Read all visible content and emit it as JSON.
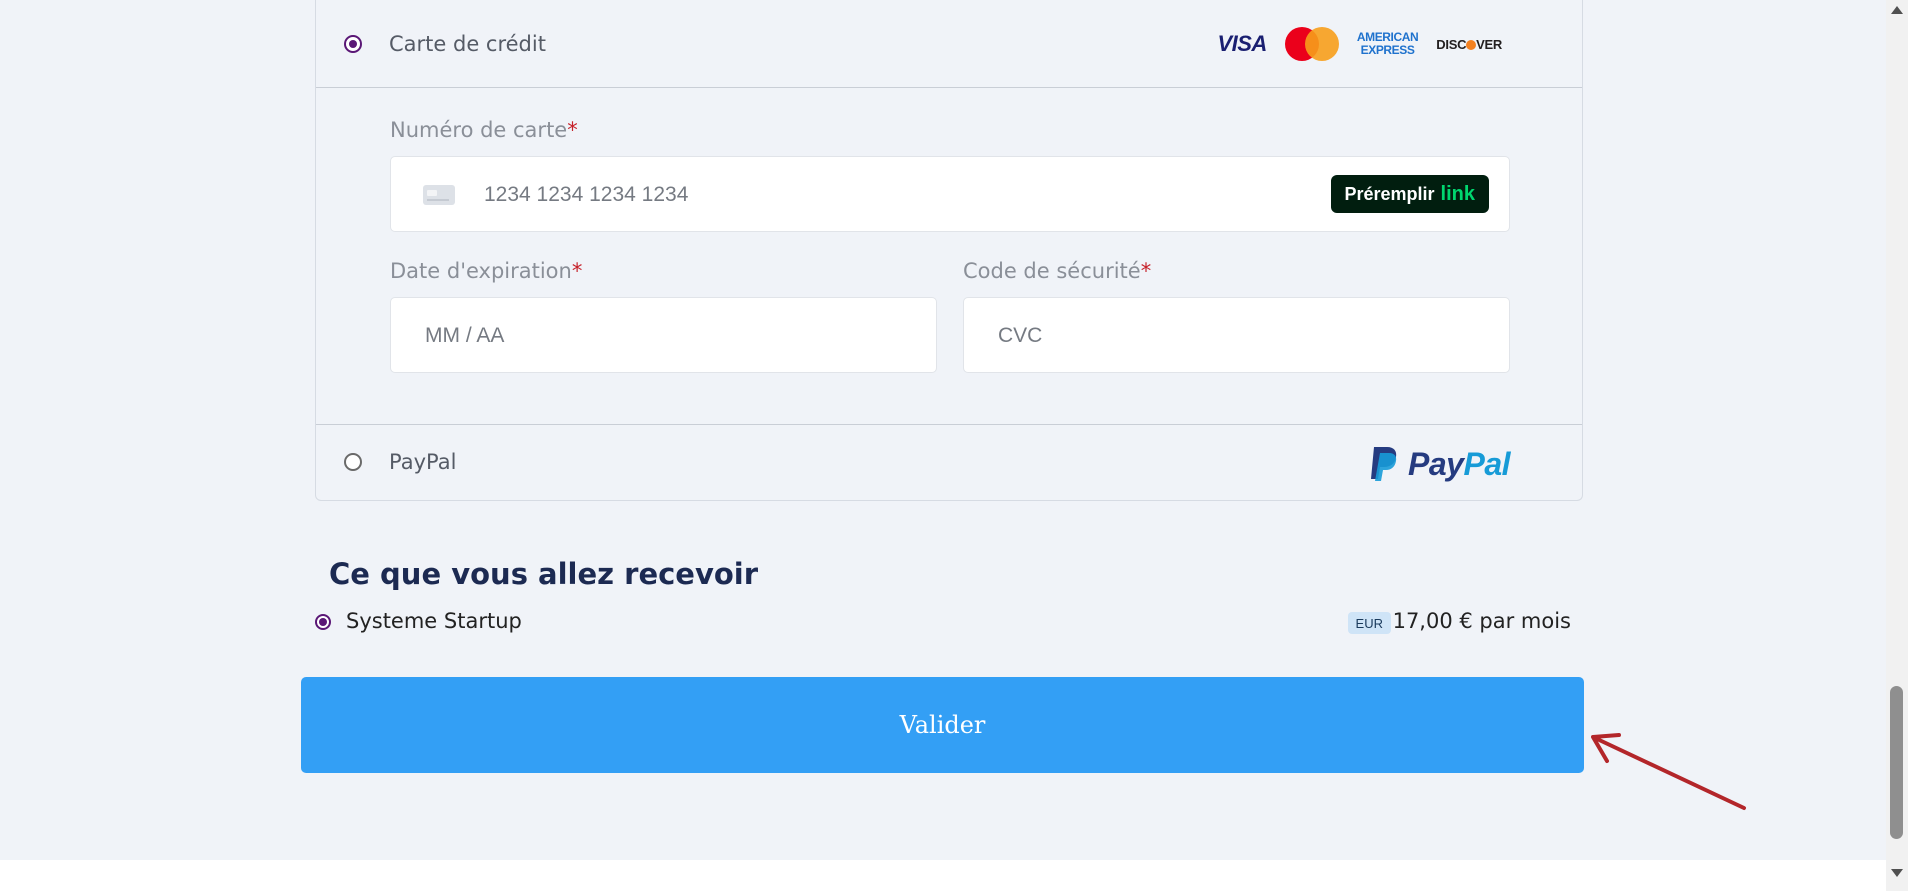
{
  "payment": {
    "card_method": {
      "label": "Carte de crédit",
      "selected": true
    },
    "brand_logos": {
      "visa": "VISA",
      "mastercard": "mastercard-logo",
      "amex_line1": "AMERICAN",
      "amex_line2": "EXPRESS",
      "discover_pre": "DISC",
      "discover_post": "VER"
    },
    "card_number": {
      "label": "Numéro de carte",
      "required_mark": "*",
      "placeholder": "1234 1234 1234 1234"
    },
    "prefill": {
      "label": "Préremplir",
      "link_word": "link"
    },
    "expiry": {
      "label": "Date d'expiration",
      "required_mark": "*",
      "placeholder": "MM / AA"
    },
    "cvc": {
      "label": "Code de sécurité",
      "required_mark": "*",
      "placeholder": "CVC"
    },
    "paypal_method": {
      "label": "PayPal",
      "selected": false,
      "logo_pay": "Pay",
      "logo_pal": "Pal"
    }
  },
  "receive": {
    "title": "Ce que vous allez recevoir",
    "plan": {
      "name": "Systeme Startup",
      "currency": "EUR",
      "price": "17,00 € par mois",
      "selected": true
    }
  },
  "submit": {
    "label": "Valider"
  },
  "colors": {
    "accent": "#339ff5",
    "radio": "#5a1776",
    "required": "#c6212a",
    "title": "#1c2a52",
    "annotation_arrow": "#b3262a"
  }
}
